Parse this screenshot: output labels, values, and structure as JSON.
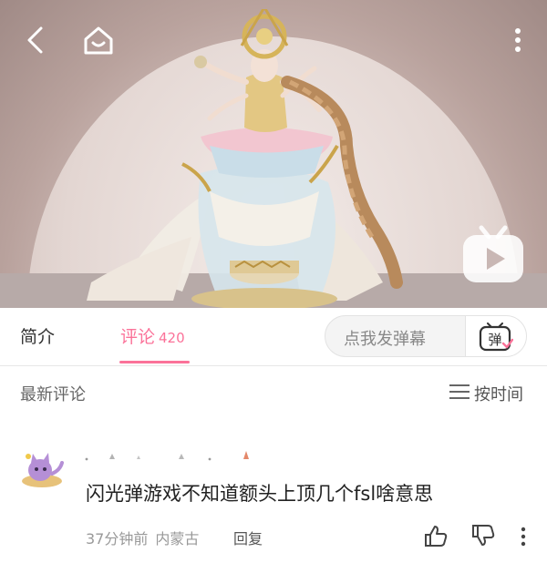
{
  "video": {
    "icons": [
      "back-arrow-icon",
      "home-icon",
      "more-vertical-icon",
      "play-badge-icon"
    ]
  },
  "tabs": {
    "intro_label": "简介",
    "comments_label": "评论",
    "comments_count": "420"
  },
  "danmaku": {
    "placeholder": "点我发弹幕",
    "button_icon": "danmaku-toggle-icon",
    "button_text": "弹"
  },
  "sort": {
    "label": "最新评论",
    "time_label": "按时间"
  },
  "comment": {
    "text": "闪光弹游戏不知道额头上顶几个fsl啥意思",
    "time": "37分钟前",
    "location": "内蒙古",
    "reply_label": "回复"
  },
  "colors": {
    "accent": "#fb7299",
    "text_primary": "#222222",
    "text_secondary": "#999999"
  }
}
